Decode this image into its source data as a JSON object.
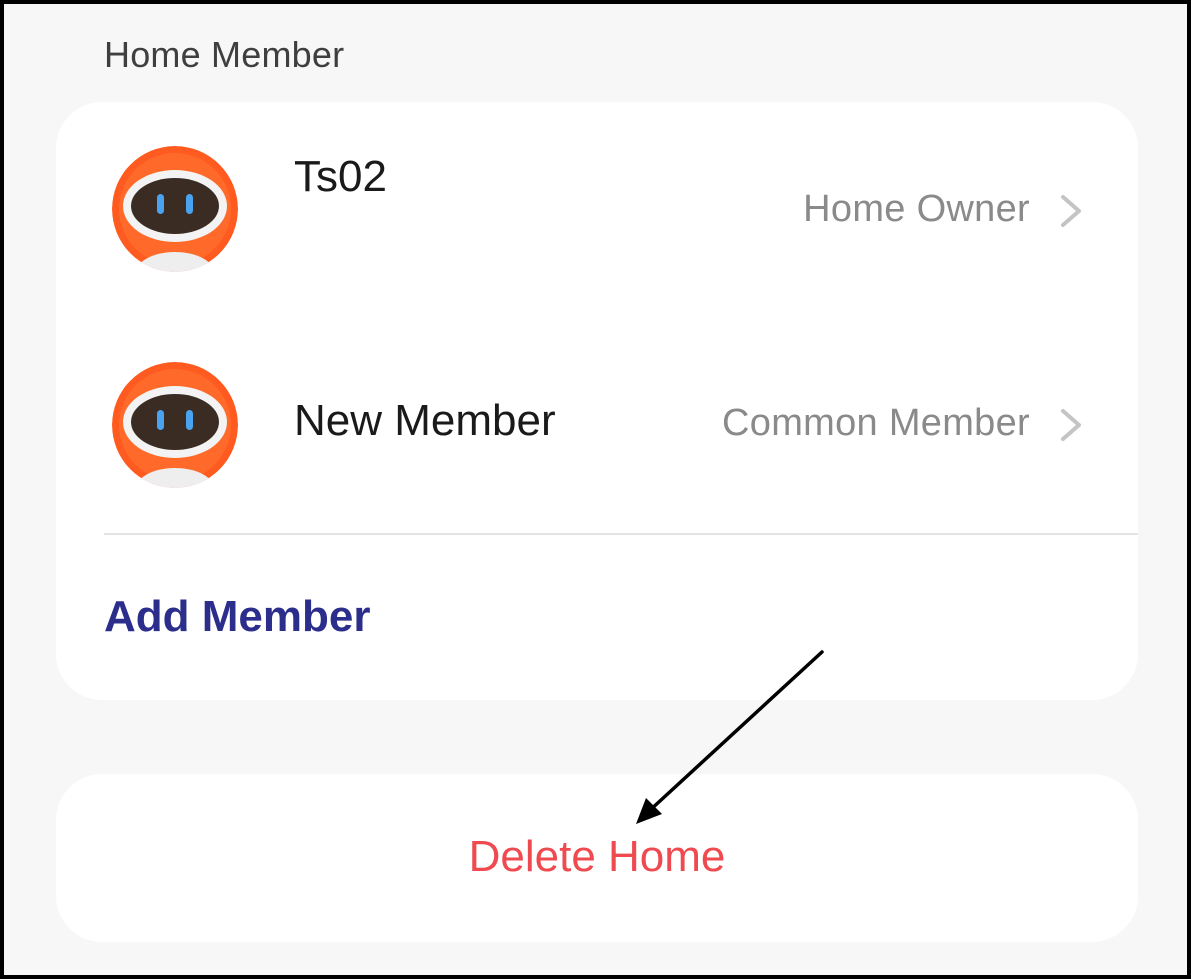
{
  "section": {
    "title": "Home Member"
  },
  "members": [
    {
      "name": "Ts02",
      "role": "Home Owner",
      "avatar": "robot-avatar-icon"
    },
    {
      "name": "New Member",
      "role": "Common Member",
      "avatar": "robot-avatar-icon"
    }
  ],
  "actions": {
    "add_member_label": "Add Member",
    "delete_home_label": "Delete Home"
  },
  "colors": {
    "background": "#f7f7f7",
    "card": "#ffffff",
    "accent_blue": "#2c2e8c",
    "danger_red": "#ee4a50",
    "secondary_text": "#8a8a8a",
    "avatar_orange": "#ff5a1f"
  },
  "icons": {
    "chevron": "chevron-right-icon",
    "annotation": "arrow-annotation"
  }
}
